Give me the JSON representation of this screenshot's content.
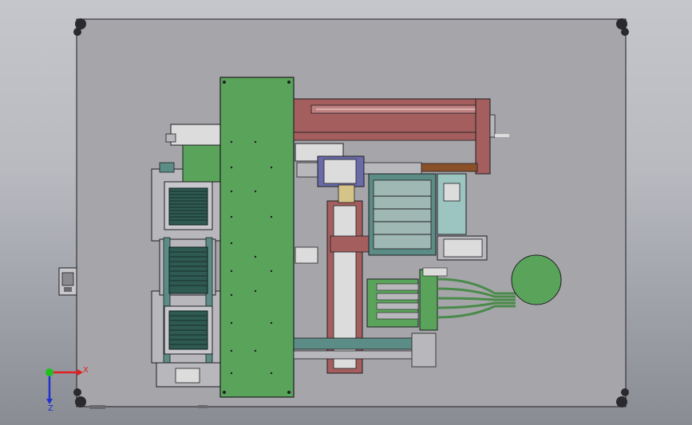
{
  "view": {
    "background_top": "#c4c6cc",
    "background_bottom": "#8a8c94"
  },
  "colors": {
    "base_plate": "#a6a6aa",
    "green_plate": "#5aa35a",
    "rail_red": "#a45e5e",
    "machine_green": "#6e9a6e",
    "teal": "#5c8c86",
    "gray_part": "#b8b8bc",
    "blue_part": "#6a6aa8",
    "brown_rod": "#8a5028",
    "outline": "#1e1e22"
  },
  "axis_triad": {
    "x_label": "X",
    "z_label": "Z",
    "x_color": "#e02020",
    "z_color": "#2030d0",
    "origin_color": "#20c020"
  }
}
